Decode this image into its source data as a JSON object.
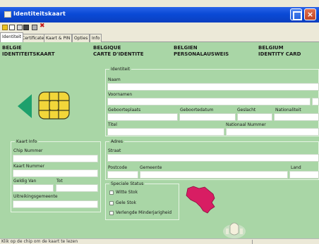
{
  "window": {
    "title": "Identiteitskaart"
  },
  "toolbar": {
    "icons": [
      "folder-icon",
      "new-document-icon",
      "open-icon",
      "save-icon",
      "print-icon",
      "delete-icon"
    ],
    "delete_glyph": "✖"
  },
  "tabs": [
    "Identiteit",
    "Certificaten",
    "Kaart & PIN",
    "Opties",
    "Info"
  ],
  "header": {
    "nl": [
      "BELGIE",
      "IDENTITEITSKAART"
    ],
    "fr": [
      "BELGIQUE",
      "CARTE D'IDENTITE"
    ],
    "de": [
      "BELGIEN",
      "PERSONALAUSWEIS"
    ],
    "en": [
      "BELGIUM",
      "IDENTITY CARD"
    ]
  },
  "identity": {
    "legend": "Identiteit",
    "labels": {
      "name": "Naam",
      "firstnames": "Voornamen",
      "birthplace": "Geboorteplaats",
      "birthdate": "Geboortedatum",
      "gender": "Geslacht",
      "nationality": "Nationaliteit",
      "title": "Titel",
      "national_number": "Nationaal Nummer"
    }
  },
  "card_info": {
    "legend": "Kaart Info",
    "labels": {
      "chip_number": "Chip Nummer",
      "card_number": "Kaart Nummer",
      "valid_from": "Geldig Van",
      "valid_to": "Tot",
      "issuing_municipality": "Uitreikingsgemeente"
    }
  },
  "address": {
    "legend": "Adres",
    "labels": {
      "street": "Straat",
      "postcode": "Postcode",
      "municipality": "Gemeente",
      "country": "Land"
    }
  },
  "special_status": {
    "legend": "Speciale Status",
    "options": [
      "Witte Stok",
      "Gele Stok",
      "Verlengde Minderjarigheid"
    ]
  },
  "colors": {
    "content_bg": "#a9d6a6",
    "titlebar": "#0a4ad6",
    "chip_gold": "#f2d63a",
    "arrow": "#1da06c",
    "map_red": "#d81d63"
  },
  "statusbar": {
    "text": "Klik op de chip om de kaart te lezen"
  }
}
